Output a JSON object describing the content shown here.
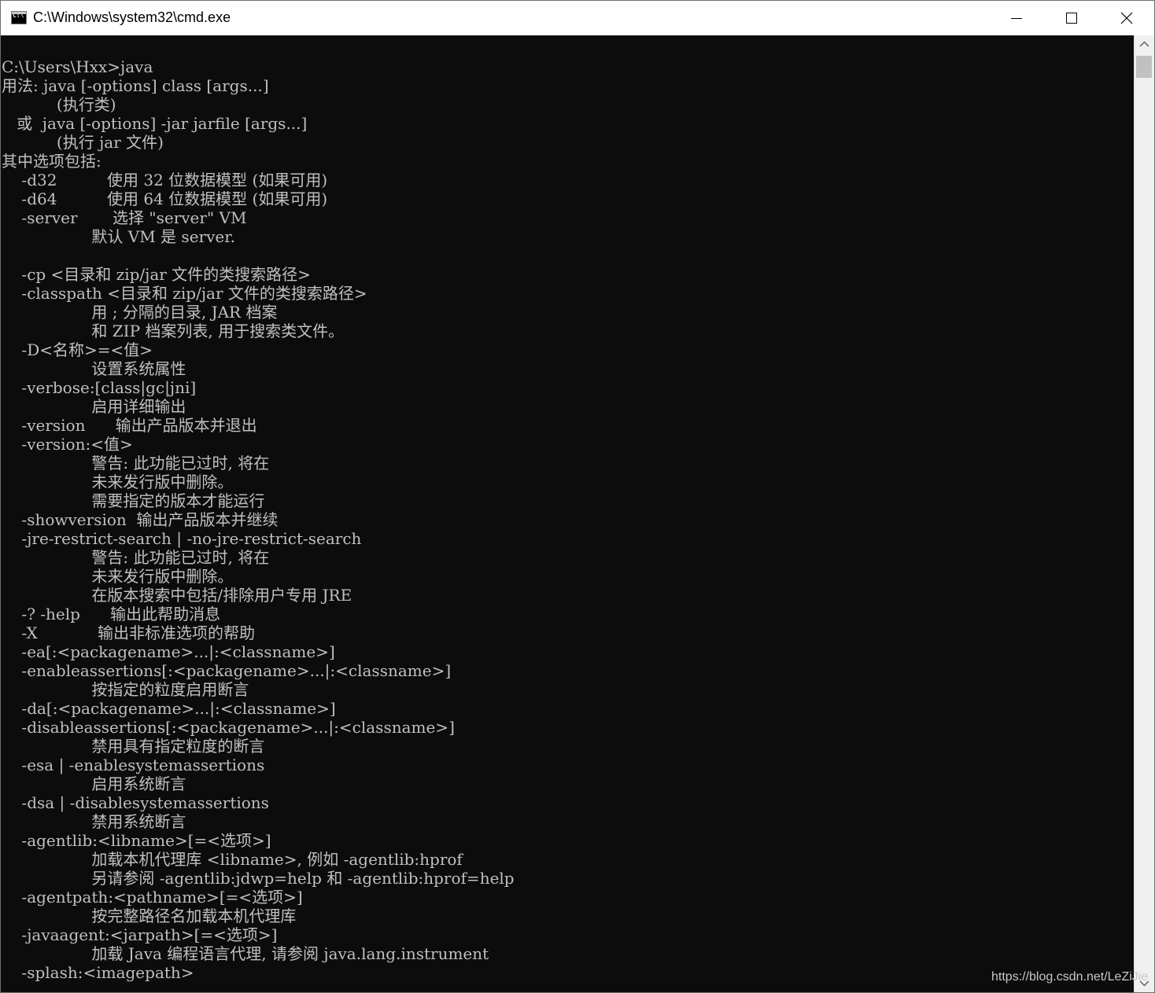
{
  "window": {
    "title": "C:\\Windows\\system32\\cmd.exe",
    "icon": "cmd-console-icon",
    "controls": [
      "minimize-icon",
      "maximize-icon",
      "close-icon"
    ]
  },
  "console": {
    "text_color": "#c0c0c0",
    "background": "#0c0c0c",
    "lines": [
      "",
      "C:\\Users\\Hxx>java",
      "用法: java [-options] class [args...]",
      "           (执行类)",
      "   或  java [-options] -jar jarfile [args...]",
      "           (执行 jar 文件)",
      "其中选项包括:",
      "    -d32          使用 32 位数据模型 (如果可用)",
      "    -d64          使用 64 位数据模型 (如果可用)",
      "    -server       选择 \"server\" VM",
      "                  默认 VM 是 server.",
      "",
      "    -cp <目录和 zip/jar 文件的类搜索路径>",
      "    -classpath <目录和 zip/jar 文件的类搜索路径>",
      "                  用 ; 分隔的目录, JAR 档案",
      "                  和 ZIP 档案列表, 用于搜索类文件。",
      "    -D<名称>=<值>",
      "                  设置系统属性",
      "    -verbose:[class|gc|jni]",
      "                  启用详细输出",
      "    -version      输出产品版本并退出",
      "    -version:<值>",
      "                  警告: 此功能已过时, 将在",
      "                  未来发行版中删除。",
      "                  需要指定的版本才能运行",
      "    -showversion  输出产品版本并继续",
      "    -jre-restrict-search | -no-jre-restrict-search",
      "                  警告: 此功能已过时, 将在",
      "                  未来发行版中删除。",
      "                  在版本搜索中包括/排除用户专用 JRE",
      "    -? -help      输出此帮助消息",
      "    -X            输出非标准选项的帮助",
      "    -ea[:<packagename>...|:<classname>]",
      "    -enableassertions[:<packagename>...|:<classname>]",
      "                  按指定的粒度启用断言",
      "    -da[:<packagename>...|:<classname>]",
      "    -disableassertions[:<packagename>...|:<classname>]",
      "                  禁用具有指定粒度的断言",
      "    -esa | -enablesystemassertions",
      "                  启用系统断言",
      "    -dsa | -disablesystemassertions",
      "                  禁用系统断言",
      "    -agentlib:<libname>[=<选项>]",
      "                  加载本机代理库 <libname>, 例如 -agentlib:hprof",
      "                  另请参阅 -agentlib:jdwp=help 和 -agentlib:hprof=help",
      "    -agentpath:<pathname>[=<选项>]",
      "                  按完整路径名加载本机代理库",
      "    -javaagent:<jarpath>[=<选项>]",
      "                  加载 Java 编程语言代理, 请参阅 java.lang.instrument",
      "    -splash:<imagepath>"
    ]
  },
  "watermark": "https://blog.csdn.net/LeZiJie"
}
